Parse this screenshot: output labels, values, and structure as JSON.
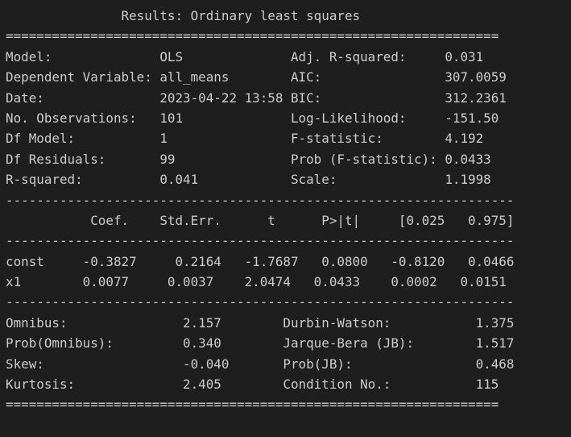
{
  "output": {
    "lines": [
      "               Results: Ordinary least squares",
      "================================================================",
      "Model:              OLS              Adj. R-squared:     0.031",
      "Dependent Variable: all_means        AIC:                307.0059",
      "Date:               2023-04-22 13:58 BIC:                312.2361",
      "No. Observations:   101              Log-Likelihood:     -151.50",
      "Df Model:           1                F-statistic:        4.192",
      "Df Residuals:       99               Prob (F-statistic): 0.0433",
      "R-squared:          0.041            Scale:              1.1998",
      "------------------------------------------------------------------",
      "           Coef.    Std.Err.      t      P>|t|     [0.025   0.975]",
      "------------------------------------------------------------------",
      "const     -0.3827     0.2164   -1.7687   0.0800   -0.8120   0.0466",
      "x1        0.0077     0.0037    2.0474   0.0433    0.0002   0.0151",
      "------------------------------------------------------------------",
      "Omnibus:               2.157        Durbin-Watson:           1.375",
      "Prob(Omnibus):         0.340        Jarque-Bera (JB):        1.517",
      "Skew:                  -0.040       Prob(JB):                0.468",
      "Kurtosis:              2.405        Condition No.:           115",
      "================================================================"
    ]
  }
}
